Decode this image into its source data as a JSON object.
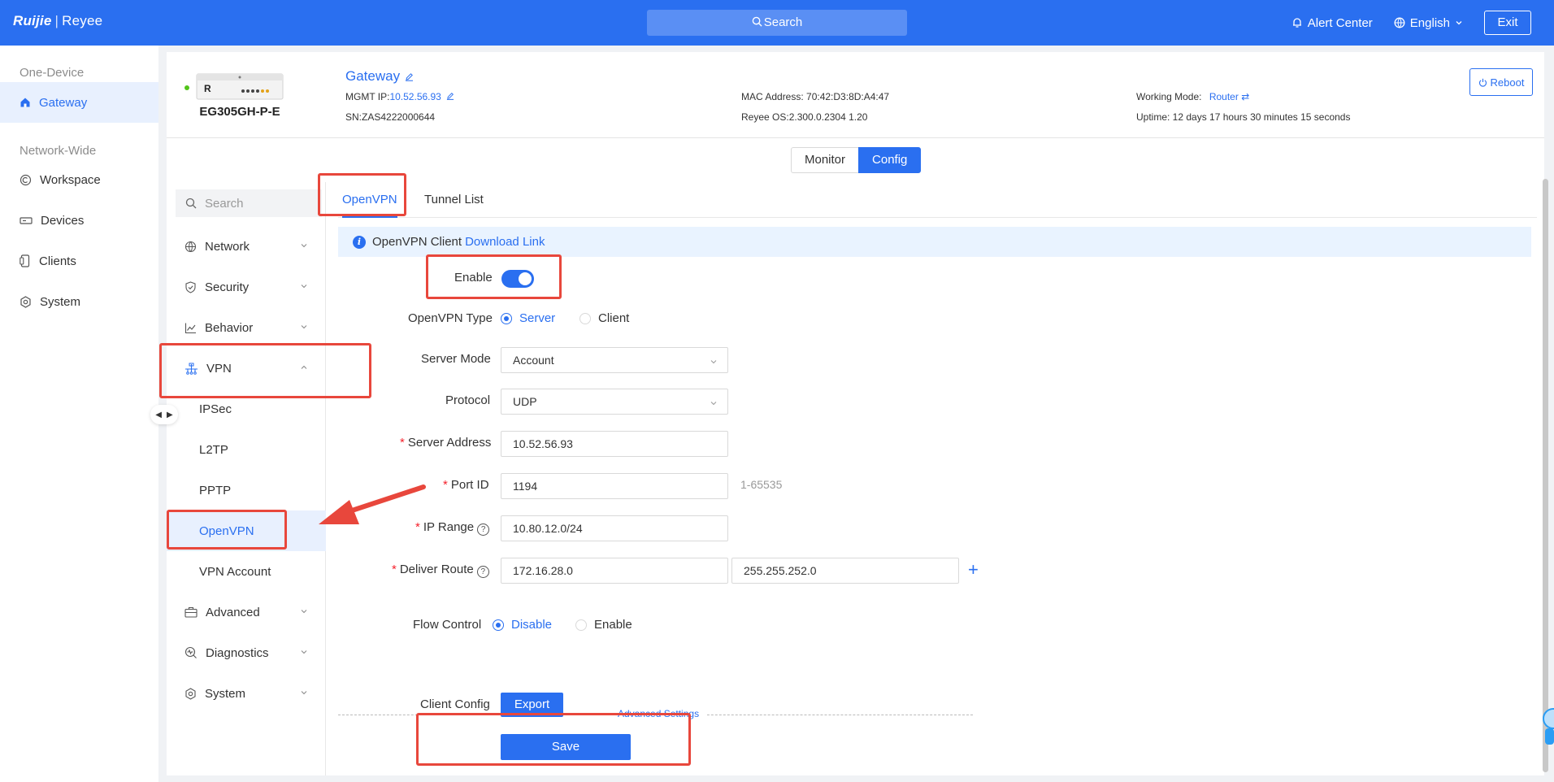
{
  "header": {
    "logo_brand": "Ruijie",
    "logo_product": "Reyee",
    "search_label": "Search",
    "alert_center": "Alert Center",
    "language": "English",
    "exit": "Exit",
    "bg_color": "#2a6ff0"
  },
  "leftnav": {
    "section_one_device": "One-Device",
    "gateway": "Gateway",
    "section_network_wide": "Network-Wide",
    "workspace": "Workspace",
    "devices": "Devices",
    "clients": "Clients",
    "system": "System"
  },
  "device": {
    "logo_letter": "R",
    "model": "EG305GH-P-E",
    "name": "Gateway",
    "mgmt_ip_label": "MGMT IP:",
    "mgmt_ip": "10.52.56.93",
    "sn": "SN:ZAS4222000644",
    "mac": "MAC Address: 70:42:D3:8D:A4:47",
    "os": "Reyee OS:2.300.0.2304 1.20",
    "working_mode_label": "Working Mode:",
    "working_mode": "Router",
    "uptime": "Uptime: 12 days 17 hours 30 minutes 15 seconds",
    "reboot": "Reboot"
  },
  "mode_toggle": {
    "monitor": "Monitor",
    "config": "Config"
  },
  "submenu": {
    "search_placeholder": "Search",
    "network": "Network",
    "security": "Security",
    "behavior": "Behavior",
    "vpn": "VPN",
    "ipsec": "IPSec",
    "l2tp": "L2TP",
    "pptp": "PPTP",
    "openvpn": "OpenVPN",
    "vpn_account": "VPN Account",
    "advanced": "Advanced",
    "diagnostics": "Diagnostics",
    "system": "System"
  },
  "tabs": {
    "openvpn": "OpenVPN",
    "tunnel_list": "Tunnel List"
  },
  "alert": {
    "text": "OpenVPN Client",
    "link": "Download Link"
  },
  "form": {
    "enable_label": "Enable",
    "enable_value": true,
    "type_label": "OpenVPN Type",
    "type_server": "Server",
    "type_client": "Client",
    "server_mode_label": "Server Mode",
    "server_mode_value": "Account",
    "protocol_label": "Protocol",
    "protocol_value": "UDP",
    "server_address_label": "Server Address",
    "server_address_value": "10.52.56.93",
    "port_label": "Port ID",
    "port_value": "1194",
    "port_hint": "1-65535",
    "ip_range_label": "IP Range",
    "ip_range_value": "10.80.12.0/24",
    "route_label": "Deliver Route",
    "route_ip": "172.16.28.0",
    "route_mask": "255.255.252.0",
    "flow_label": "Flow Control",
    "flow_disable": "Disable",
    "flow_enable": "Enable",
    "advanced_settings": "Advanced Settings",
    "client_config_label": "Client Config",
    "export": "Export",
    "save": "Save"
  },
  "colors": {
    "accent": "#2a6ff0",
    "highlight": "#e8473c",
    "required": "#f5222d"
  }
}
